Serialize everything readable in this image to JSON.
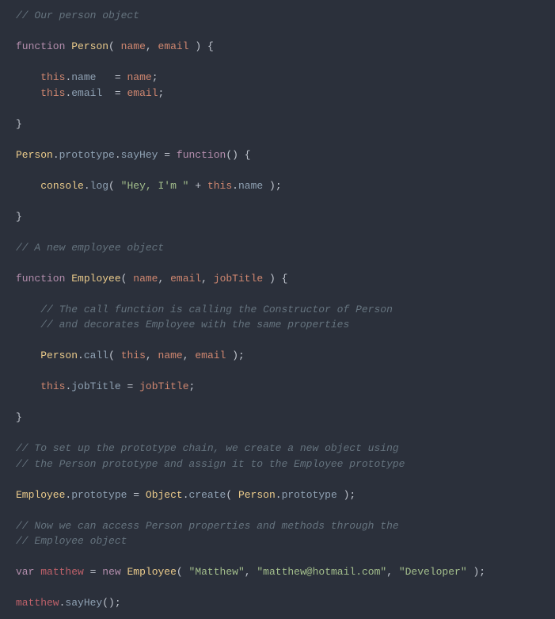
{
  "code": {
    "c1": "// Our person object",
    "kw_function": "function",
    "cls_person": "Person",
    "p_name": "name",
    "p_email": "email",
    "p_jobtitle": "jobTitle",
    "kw_this": "this",
    "prop_name": "name",
    "prop_email": "email",
    "prop_jobtitle": "jobTitle",
    "prop_prototype": "prototype",
    "m_sayhey": "sayHey",
    "m_log": "log",
    "m_call": "call",
    "m_create": "create",
    "obj_console": "console",
    "obj_object": "Object",
    "s_hey": "\"Hey, I'm \"",
    "s_matthew": "\"Matthew\"",
    "s_email": "\"matthew@hotmail.com\"",
    "s_dev": "\"Developer\"",
    "c2": "// A new employee object",
    "cls_employee": "Employee",
    "c3a": "// The call function is calling the Constructor of Person",
    "c3b": "// and decorates Employee with the same properties",
    "c4a": "// To set up the prototype chain, we create a new object using",
    "c4b": "// the Person prototype and assign it to the Employee prototype",
    "c5a": "// Now we can access Person properties and methods through the",
    "c5b": "// Employee object",
    "kw_var": "var",
    "kw_new": "new",
    "var_matthew": "matthew",
    "eq": "=",
    "plus": "+",
    "semi": ";",
    "dot": ".",
    "comma": ",",
    "lp": "(",
    "rp": ")",
    "lb": "{",
    "rb": "}"
  }
}
